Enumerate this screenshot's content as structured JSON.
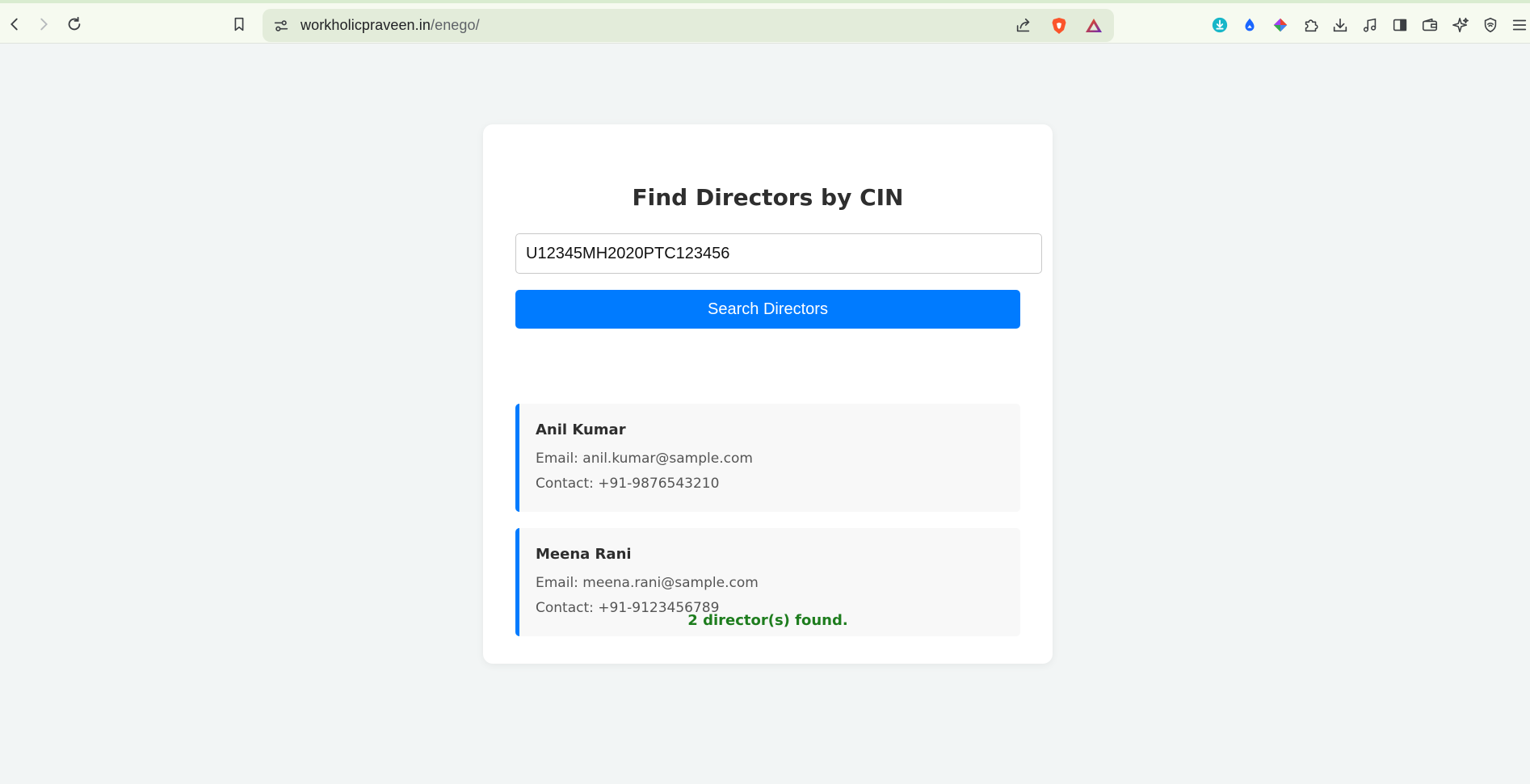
{
  "browser": {
    "url_host": "workholicpraveen.in",
    "url_path": "/enego/"
  },
  "app": {
    "title": "Find Directors by CIN",
    "search": {
      "value": "U12345MH2020PTC123456",
      "button_label": "Search Directors"
    },
    "directors": [
      {
        "name": "Anil Kumar",
        "email": "Email: anil.kumar@sample.com",
        "contact": "Contact: +91-9876543210"
      },
      {
        "name": "Meena Rani",
        "email": "Email: meena.rani@sample.com",
        "contact": "Contact: +91-9123456789"
      }
    ],
    "result_text": "2 director(s) found."
  },
  "colors": {
    "accent": "#007bff",
    "success": "#1e7d1e"
  },
  "icons": [
    "back-icon",
    "forward-icon",
    "reload-icon",
    "bookmark-icon",
    "site-settings-icon",
    "share-icon",
    "brave-shield-icon",
    "brave-rewards-icon",
    "download-ext-icon",
    "drive-ext-icon",
    "color-ext-icon",
    "extensions-icon",
    "downloads-icon",
    "media-icon",
    "sidebar-icon",
    "wallet-icon",
    "leo-ai-icon",
    "vpn-icon",
    "menu-icon"
  ]
}
